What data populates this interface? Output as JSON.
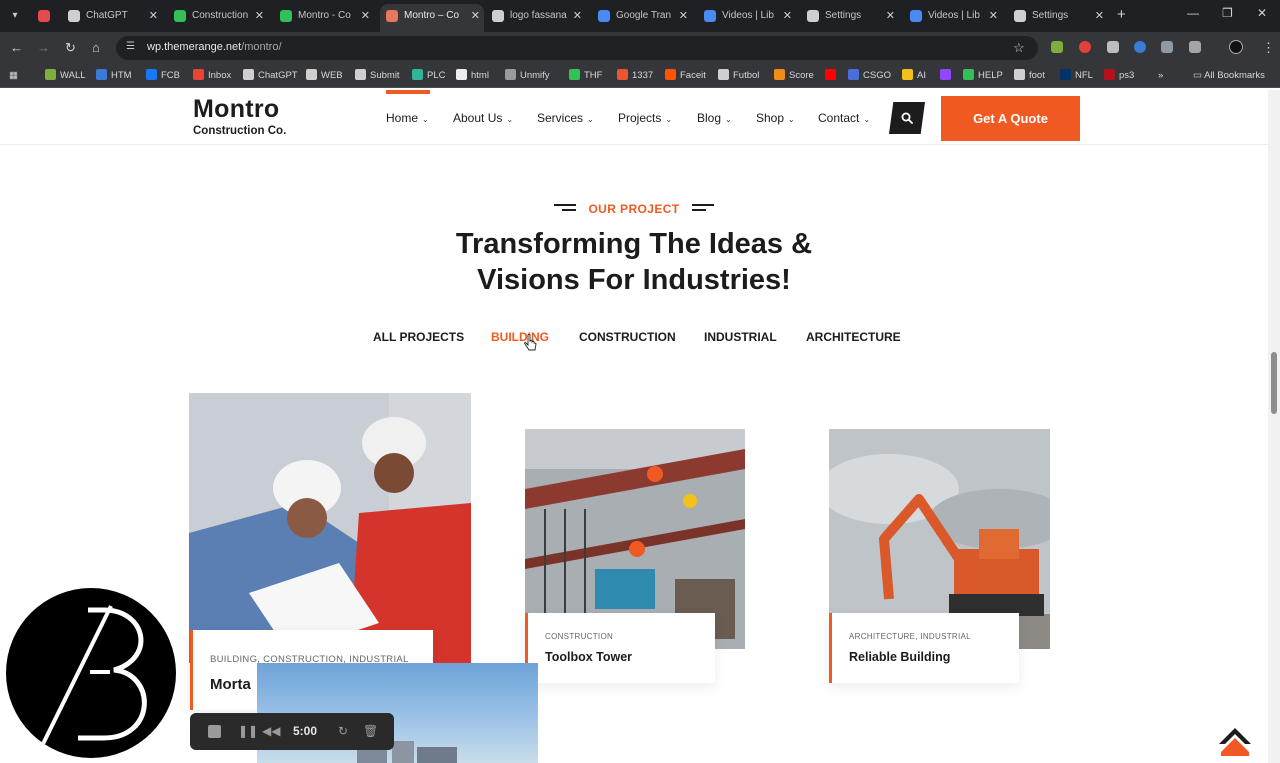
{
  "browser": {
    "tabs": [
      {
        "label": "",
        "color": "#e34c4c"
      },
      {
        "label": "ChatGPT",
        "color": "#cfcfcf"
      },
      {
        "label": "Construction",
        "color": "#33c157"
      },
      {
        "label": "Montro - Co",
        "color": "#33c157"
      },
      {
        "label": "Montro – Co",
        "color": "#e8785a",
        "active": true
      },
      {
        "label": "logo fassana",
        "color": "#cfcfcf"
      },
      {
        "label": "Google Tran",
        "color": "#4a8af4"
      },
      {
        "label": "Videos | Lib",
        "color": "#4a8af4"
      },
      {
        "label": "Settings",
        "color": "#cfcfcf"
      },
      {
        "label": "Videos | Lib",
        "color": "#4a8af4"
      },
      {
        "label": "Settings",
        "color": "#cfcfcf"
      }
    ],
    "url_host": "wp.themerange.net",
    "url_path": "/montro/",
    "bookmarks": [
      {
        "label": "WALL",
        "color": "#7fae3f"
      },
      {
        "label": "HTM",
        "color": "#3a7bd5"
      },
      {
        "label": "FCB",
        "color": "#1877f2"
      },
      {
        "label": "Inbox",
        "color": "#ea4335"
      },
      {
        "label": "ChatGPT",
        "color": "#cfcfcf"
      },
      {
        "label": "WEB",
        "color": "#cfcfcf"
      },
      {
        "label": "Submit",
        "color": "#cfcfcf"
      },
      {
        "label": "PLC",
        "color": "#2fb39a"
      },
      {
        "label": "html",
        "color": "#eeeeee"
      },
      {
        "label": "Unmify",
        "color": "#9a9a9a"
      },
      {
        "label": "THF",
        "color": "#33c157"
      },
      {
        "label": "1337",
        "color": "#e8552f"
      },
      {
        "label": "Faceit",
        "color": "#ff5500"
      },
      {
        "label": "Futbol",
        "color": "#cfcfcf"
      },
      {
        "label": "Score",
        "color": "#f08c1a"
      },
      {
        "label": "",
        "color": "#ff0000"
      },
      {
        "label": "CSGO",
        "color": "#4a6fd8"
      },
      {
        "label": "AI",
        "color": "#f2c21b"
      },
      {
        "label": "",
        "color": "#9146ff"
      },
      {
        "label": "HELP",
        "color": "#33c157"
      },
      {
        "label": "foot",
        "color": "#cfcfcf"
      },
      {
        "label": "NFL",
        "color": "#013369"
      },
      {
        "label": "ps3",
        "color": "#b3121b"
      }
    ],
    "all_bookmarks": "All Bookmarks"
  },
  "site": {
    "logo_main": "Montro",
    "logo_sub": "Construction Co.",
    "nav": [
      "Home",
      "About Us",
      "Services",
      "Projects",
      "Blog",
      "Shop",
      "Contact"
    ],
    "cta": "Get A Quote"
  },
  "section": {
    "eyebrow": "OUR PROJECT",
    "headline_line1": "Transforming The Ideas &",
    "headline_line2": "Visions For Industries!",
    "filters": [
      "ALL PROJECTS",
      "BUILDING",
      "CONSTRUCTION",
      "INDUSTRIAL",
      "ARCHITECTURE"
    ],
    "active_filter": "BUILDING"
  },
  "cards": [
    {
      "category": "BUILDING, CONSTRUCTION, INDUSTRIAL",
      "title": "Morta"
    },
    {
      "category": "CONSTRUCTION",
      "title": "Toolbox Tower"
    },
    {
      "category": "ARCHITECTURE, INDUSTRIAL",
      "title": "Reliable Building"
    }
  ],
  "recorder": {
    "time": "5:00"
  },
  "colors": {
    "accent": "#f05a22",
    "dark": "#1c1c1c"
  }
}
